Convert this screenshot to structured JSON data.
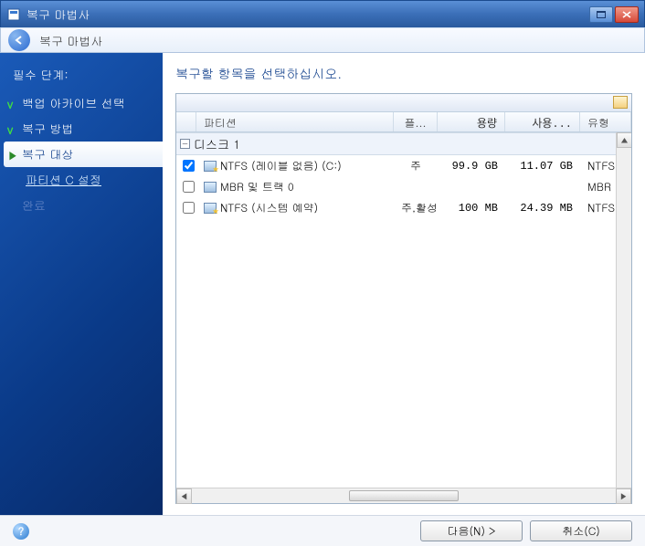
{
  "window": {
    "title": "복구 마법사"
  },
  "toolbar": {
    "title": "복구 마법사"
  },
  "sidebar": {
    "section_title": "필수 단계:",
    "steps": [
      {
        "label": "백업 아카이브 선택",
        "state": "done"
      },
      {
        "label": "복구 방법",
        "state": "done"
      },
      {
        "label": "복구 대상",
        "state": "current"
      },
      {
        "label": "파티션 C 설정",
        "state": "link"
      },
      {
        "label": "완료",
        "state": "dim"
      }
    ]
  },
  "content": {
    "title": "복구할 항목을 선택하십시오.",
    "columns": {
      "partition": "파티션",
      "flags": "플...",
      "capacity": "용량",
      "used": "사용...",
      "type": "유형"
    },
    "group": {
      "label": "디스크 1"
    },
    "rows": [
      {
        "checked": true,
        "icon": "star",
        "name": "NTFS (레이블 없음) (C:)",
        "flags": "주",
        "capacity": "99.9 GB",
        "used": "11.07 GB",
        "type": "NTFS"
      },
      {
        "checked": false,
        "icon": "plain",
        "name": "MBR 및 트랙 0",
        "flags": "",
        "capacity": "",
        "used": "",
        "type": "MBR 및 !"
      },
      {
        "checked": false,
        "icon": "star",
        "name": "NTFS (시스템 예약)",
        "flags": "주,활성",
        "capacity": "100 MB",
        "used": "24.39 MB",
        "type": "NTFS"
      }
    ]
  },
  "footer": {
    "next": "다음(N) >",
    "cancel": "취소(C)"
  }
}
